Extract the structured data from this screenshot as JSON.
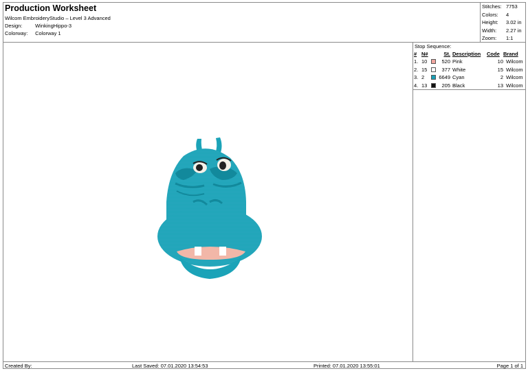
{
  "header": {
    "title": "Production Worksheet",
    "software": "Wilcom EmbroideryStudio – Level 3 Advanced",
    "design_label": "Design:",
    "design_value": "WinkingHippo-3",
    "colorway_label": "Colorway:",
    "colorway_value": "Colorway 1"
  },
  "stats": [
    {
      "label": "Stitches:",
      "value": "7753"
    },
    {
      "label": "Colors:",
      "value": "4"
    },
    {
      "label": "Height:",
      "value": "3.02 in"
    },
    {
      "label": "Width:",
      "value": "2.27 in"
    },
    {
      "label": "Zoom:",
      "value": "1:1"
    }
  ],
  "stop_sequence": {
    "title": "Stop Sequence:",
    "columns": [
      "#",
      "N#",
      "St.",
      "Description",
      "Code",
      "Brand"
    ],
    "rows": [
      {
        "index": "1.",
        "n": "10",
        "swatch": "#f2a7a0",
        "st": "520",
        "description": "Pink",
        "code": "10",
        "brand": "Wilcom"
      },
      {
        "index": "2.",
        "n": "15",
        "swatch": "#ffffff",
        "st": "377",
        "description": "White",
        "code": "15",
        "brand": "Wilcom"
      },
      {
        "index": "3.",
        "n": "2",
        "swatch": "#1a9fb5",
        "st": "6649",
        "description": "Cyan",
        "code": "2",
        "brand": "Wilcom"
      },
      {
        "index": "4.",
        "n": "13",
        "swatch": "#111111",
        "st": "205",
        "description": "Black",
        "code": "13",
        "brand": "Wilcom"
      }
    ]
  },
  "footer": {
    "created_by": "Created By:",
    "last_saved": "Last Saved: 07.01.2020 13:54:53",
    "printed": "Printed: 07.01.2020 13:55:01",
    "page": "Page 1 of 1"
  },
  "colors": {
    "hippo_main": "#1ba3b8",
    "hippo_dark": "#12899c",
    "mouth": "#f2b7a8",
    "teeth": "#ffffff",
    "border": "#8a8a8a"
  }
}
